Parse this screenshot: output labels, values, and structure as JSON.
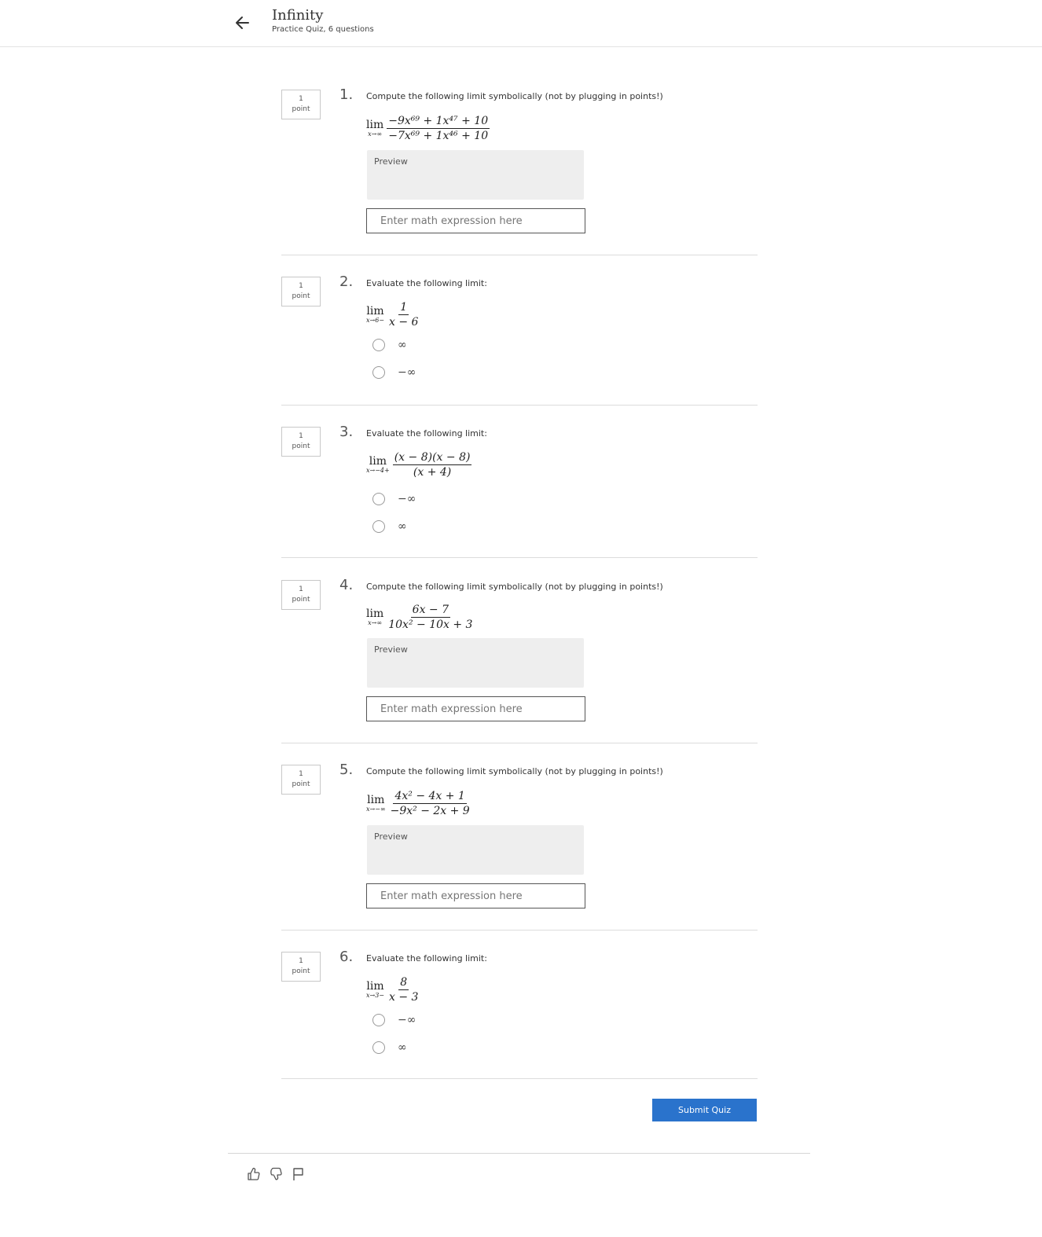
{
  "header": {
    "title": "Infinity",
    "subtitle": "Practice Quiz, 6 questions",
    "back_icon": "arrow-left-icon"
  },
  "questions": [
    {
      "number": "1.",
      "points": "1",
      "points_unit": "point",
      "prompt": "Compute the following limit symbolically (not by plugging in points!)",
      "limit": {
        "word": "lim",
        "sub": "x→∞",
        "numerator": "−9x⁶⁹ + 1x⁴⁷ + 10",
        "denominator": "−7x⁶⁹ + 1x⁴⁶ + 10"
      },
      "preview_label": "Preview",
      "input_placeholder": "Enter math expression here"
    },
    {
      "number": "2.",
      "points": "1",
      "points_unit": "point",
      "prompt": "Evaluate the following limit:",
      "limit": {
        "word": "lim",
        "sub": "x→6−",
        "numerator": "1",
        "denominator": "x − 6"
      },
      "options": [
        "∞",
        "−∞"
      ]
    },
    {
      "number": "3.",
      "points": "1",
      "points_unit": "point",
      "prompt": "Evaluate the following limit:",
      "limit": {
        "word": "lim",
        "sub": "x→−4+",
        "numerator": "(x − 8)(x − 8)",
        "denominator": "(x + 4)"
      },
      "options": [
        "−∞",
        "∞"
      ]
    },
    {
      "number": "4.",
      "points": "1",
      "points_unit": "point",
      "prompt": "Compute the following limit symbolically (not by plugging in points!)",
      "limit": {
        "word": "lim",
        "sub": "x→∞",
        "numerator": "6x − 7",
        "denominator": "10x² − 10x + 3"
      },
      "preview_label": "Preview",
      "input_placeholder": "Enter math expression here"
    },
    {
      "number": "5.",
      "points": "1",
      "points_unit": "point",
      "prompt": "Compute the following limit symbolically (not by plugging in points!)",
      "limit": {
        "word": "lim",
        "sub": "x→−∞",
        "numerator": "4x² − 4x + 1",
        "denominator": "−9x² − 2x + 9"
      },
      "preview_label": "Preview",
      "input_placeholder": "Enter math expression here"
    },
    {
      "number": "6.",
      "points": "1",
      "points_unit": "point",
      "prompt": "Evaluate the following limit:",
      "limit": {
        "word": "lim",
        "sub": "x→3−",
        "numerator": "8",
        "denominator": "x − 3"
      },
      "options": [
        "−∞",
        "∞"
      ]
    }
  ],
  "submit_label": "Submit Quiz",
  "footer_icons": [
    "thumbs-up-icon",
    "thumbs-down-icon",
    "flag-icon"
  ],
  "colors": {
    "accent": "#2a73cc",
    "preview_bg": "#eeeeee",
    "divider": "#dcdcdc"
  }
}
